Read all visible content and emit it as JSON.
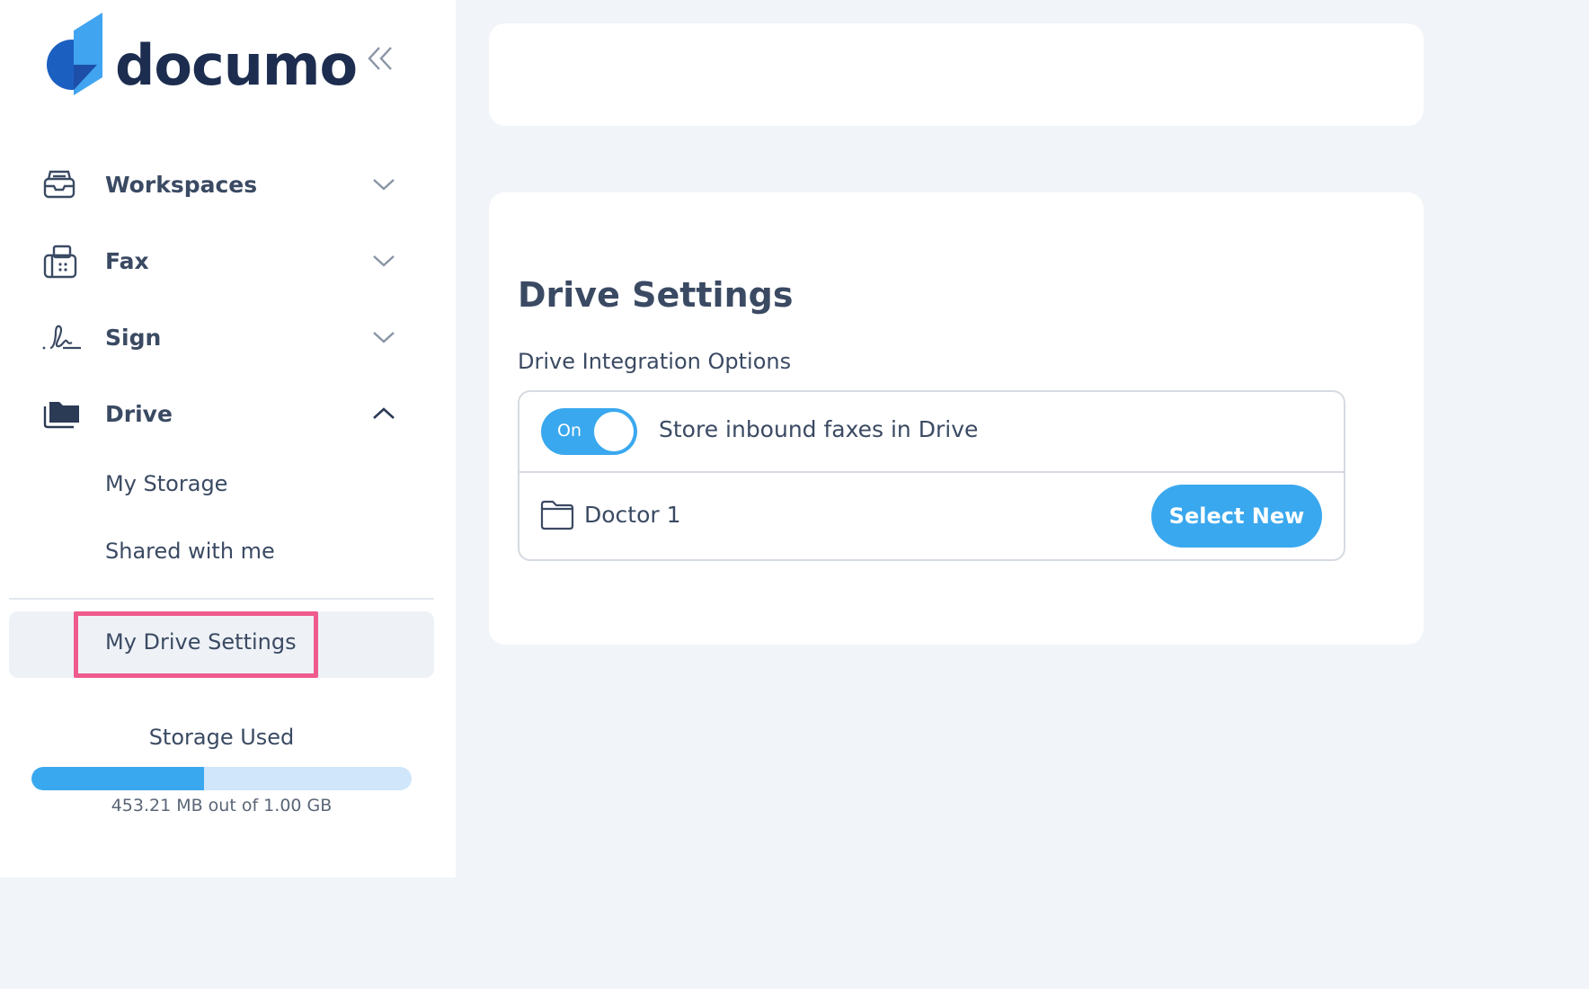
{
  "brand": {
    "name": "documo"
  },
  "sidebar": {
    "collapse_icon": "double-chevron-left-icon",
    "items": [
      {
        "label": "Workspaces",
        "icon": "inbox-tray-icon",
        "expanded": false
      },
      {
        "label": "Fax",
        "icon": "fax-machine-icon",
        "expanded": false
      },
      {
        "label": "Sign",
        "icon": "signature-icon",
        "expanded": false
      },
      {
        "label": "Drive",
        "icon": "folder-stack-icon",
        "expanded": true
      }
    ],
    "drive_subitems": [
      "My Storage",
      "Shared with me"
    ],
    "settings_item": "My Drive Settings"
  },
  "storage": {
    "title": "Storage Used",
    "text": "453.21 MB out of 1.00 GB",
    "used_fraction": 0.4532
  },
  "main": {
    "title": "Drive Settings",
    "section_label": "Drive Integration Options",
    "toggle": {
      "state_label": "On",
      "is_on": true,
      "description": "Store inbound faxes in Drive"
    },
    "folder": {
      "name": "Doctor 1",
      "button_label": "Select New"
    }
  },
  "colors": {
    "accent": "#3aa8ee",
    "highlight": "#ef5a8c",
    "text": "#3b4a63",
    "background": "#f1f4f8"
  }
}
